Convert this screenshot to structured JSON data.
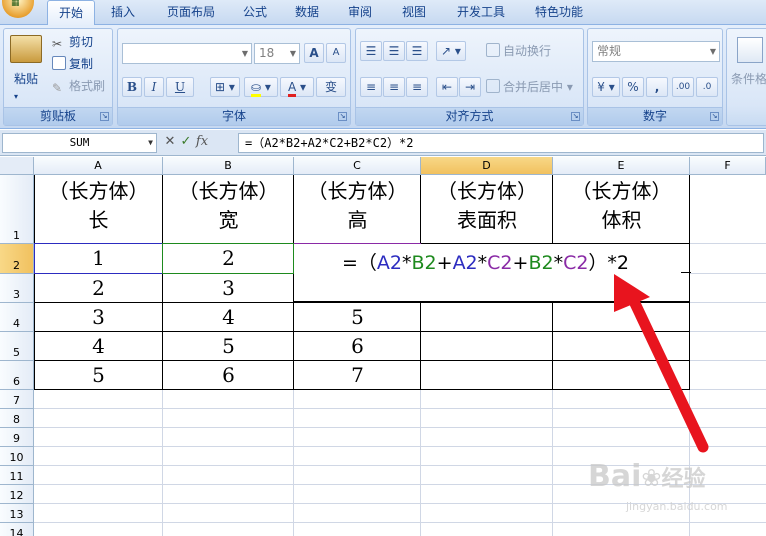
{
  "ribbon": {
    "tabs": [
      "开始",
      "插入",
      "页面布局",
      "公式",
      "数据",
      "审阅",
      "视图",
      "开发工具",
      "特色功能"
    ],
    "active_tab": "开始",
    "clipboard": {
      "paste": "粘贴",
      "cut": "剪切",
      "copy": "复制",
      "format_painter": "格式刷",
      "label": "剪贴板"
    },
    "font": {
      "font_size": "18",
      "bold": "B",
      "italic": "I",
      "underline": "U",
      "label": "字体",
      "grow": "A",
      "shrink": "A",
      "phonetic": "变"
    },
    "alignment": {
      "wrap_text": "自动换行",
      "merge_center": "合并后居中",
      "label": "对齐方式"
    },
    "number": {
      "format": "常规",
      "percent": "%",
      "comma": ",",
      "inc_decimal": ".00",
      "dec_decimal": ".0",
      "label": "数字"
    },
    "styles": {
      "conditional": "条件格"
    }
  },
  "formula_bar": {
    "name_box": "SUM",
    "cancel": "✕",
    "enter": "✓",
    "fx": "fx",
    "content": "=（A2*B2+A2*C2+B2*C2）*2"
  },
  "sheet": {
    "columns": [
      "A",
      "B",
      "C",
      "D",
      "E",
      "F"
    ],
    "rows": [
      "1",
      "2",
      "3",
      "4",
      "5",
      "6",
      "7",
      "8",
      "9",
      "10",
      "11",
      "12",
      "13",
      "14"
    ],
    "header_row": [
      [
        "（长方体）",
        "长"
      ],
      [
        "（长方体）",
        "宽"
      ],
      [
        "（长方体）",
        "高"
      ],
      [
        "（长方体）",
        "表面积"
      ],
      [
        "（长方体）",
        "体积"
      ]
    ],
    "data": [
      [
        "1",
        "2",
        ""
      ],
      [
        "2",
        "3",
        ""
      ],
      [
        "3",
        "4",
        "5"
      ],
      [
        "4",
        "5",
        "6"
      ],
      [
        "5",
        "6",
        "7"
      ]
    ],
    "editing_formula": {
      "prefix": "=（",
      "parts": [
        {
          "t": "A2",
          "c": "#2c2cc0"
        },
        {
          "t": "*",
          "c": "#000000"
        },
        {
          "t": "B2",
          "c": "#1e8a1e"
        },
        {
          "t": "+",
          "c": "#000000"
        },
        {
          "t": "A2",
          "c": "#2c2cc0"
        },
        {
          "t": "*",
          "c": "#000000"
        },
        {
          "t": "C2",
          "c": "#8a2aa6"
        },
        {
          "t": "+",
          "c": "#000000"
        },
        {
          "t": "B2",
          "c": "#1e8a1e"
        },
        {
          "t": "*",
          "c": "#000000"
        },
        {
          "t": "C2",
          "c": "#8a2aa6"
        }
      ],
      "suffix": "）*2"
    }
  },
  "watermark": {
    "brand": "Bai",
    "brand2": "经验",
    "url": "jingyan.baidu.com"
  },
  "colors": {
    "arrow": "#e8141e",
    "ref_a2": "#2c2cc0",
    "ref_b2": "#1e8a1e",
    "ref_c2": "#8a2aa6"
  }
}
